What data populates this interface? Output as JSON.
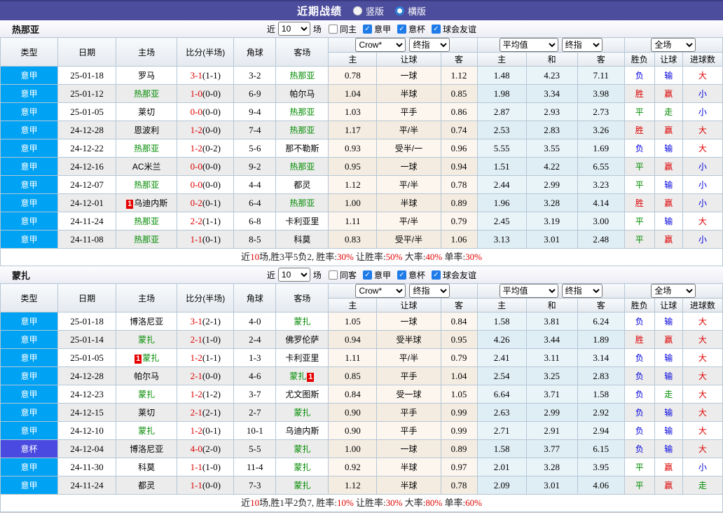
{
  "title_bar": {
    "title": "近期战绩",
    "radios": [
      {
        "label": "竖版",
        "checked": false
      },
      {
        "label": "横版",
        "checked": true
      }
    ]
  },
  "colors": {
    "titlebar_bg": "#4d4d9e",
    "serie_a_bg": "#00a2f3",
    "italy_cup_bg": "#4a4ae0",
    "win_red": "#dd0000",
    "draw_green": "#008a00",
    "lose_blue": "#0000dd",
    "team_green": "#008a00"
  },
  "columns": {
    "type": "类型",
    "date": "日期",
    "home": "主场",
    "score": "比分(半场)",
    "corner": "角球",
    "away": "客场",
    "odds_home": "主",
    "odds_handicap": "让球",
    "odds_away": "客",
    "avg_home": "主",
    "avg_draw": "和",
    "avg_away": "客",
    "result_wdl": "胜负",
    "result_handicap": "让球",
    "result_goals": "进球数"
  },
  "selects": {
    "source": "Crow*",
    "source_time": "终指",
    "average": "平均值",
    "average_time": "终指",
    "scope": "全场"
  },
  "sections": [
    {
      "team": "热那亚",
      "controls": {
        "near": "近",
        "count": "10",
        "games": "场",
        "same": {
          "label": "同主",
          "checked": false
        },
        "leagues": [
          {
            "label": "意甲",
            "checked": true
          },
          {
            "label": "意杯",
            "checked": true
          },
          {
            "label": "球会友谊",
            "checked": true
          }
        ]
      },
      "rows": [
        {
          "lg": "意甲",
          "lgc": "jia",
          "date": "25-01-18",
          "h": "罗马",
          "hg": false,
          "hb": "",
          "hba": "",
          "ft": "3-1",
          "ht": "(1-1)",
          "cn": "3-2",
          "a": "热那亚",
          "ag": true,
          "ab": "",
          "aba": "",
          "c1": "0.78",
          "chd": "一球",
          "c2": "1.12",
          "m1": "1.48",
          "mx": "4.23",
          "m2": "7.11",
          "r1": "负",
          "r2": "输",
          "r3": "大"
        },
        {
          "lg": "意甲",
          "lgc": "jia",
          "date": "25-01-12",
          "h": "热那亚",
          "hg": true,
          "hb": "",
          "hba": "",
          "ft": "1-0",
          "ht": "(0-0)",
          "cn": "6-9",
          "a": "帕尔马",
          "ag": false,
          "ab": "",
          "aba": "",
          "c1": "1.04",
          "chd": "半球",
          "c2": "0.85",
          "m1": "1.98",
          "mx": "3.34",
          "m2": "3.98",
          "r1": "胜",
          "r2": "赢",
          "r3": "小"
        },
        {
          "lg": "意甲",
          "lgc": "jia",
          "date": "25-01-05",
          "h": "莱切",
          "hg": false,
          "hb": "",
          "hba": "",
          "ft": "0-0",
          "ht": "(0-0)",
          "cn": "9-4",
          "a": "热那亚",
          "ag": true,
          "ab": "",
          "aba": "",
          "c1": "1.03",
          "chd": "平手",
          "c2": "0.86",
          "m1": "2.87",
          "mx": "2.93",
          "m2": "2.73",
          "r1": "平",
          "r2": "走",
          "r3": "小"
        },
        {
          "lg": "意甲",
          "lgc": "jia",
          "date": "24-12-28",
          "h": "恩波利",
          "hg": false,
          "hb": "",
          "hba": "",
          "ft": "1-2",
          "ht": "(0-0)",
          "cn": "7-4",
          "a": "热那亚",
          "ag": true,
          "ab": "",
          "aba": "",
          "c1": "1.17",
          "chd": "平/半",
          "c2": "0.74",
          "m1": "2.53",
          "mx": "2.83",
          "m2": "3.26",
          "r1": "胜",
          "r2": "赢",
          "r3": "大"
        },
        {
          "lg": "意甲",
          "lgc": "jia",
          "date": "24-12-22",
          "h": "热那亚",
          "hg": true,
          "hb": "",
          "hba": "",
          "ft": "1-2",
          "ht": "(0-2)",
          "cn": "5-6",
          "a": "那不勒斯",
          "ag": false,
          "ab": "",
          "aba": "",
          "c1": "0.93",
          "chd": "受半/一",
          "c2": "0.96",
          "m1": "5.55",
          "mx": "3.55",
          "m2": "1.69",
          "r1": "负",
          "r2": "输",
          "r3": "大"
        },
        {
          "lg": "意甲",
          "lgc": "jia",
          "date": "24-12-16",
          "h": "AC米兰",
          "hg": false,
          "hb": "",
          "hba": "",
          "ft": "0-0",
          "ht": "(0-0)",
          "cn": "9-2",
          "a": "热那亚",
          "ag": true,
          "ab": "",
          "aba": "",
          "c1": "0.95",
          "chd": "一球",
          "c2": "0.94",
          "m1": "1.51",
          "mx": "4.22",
          "m2": "6.55",
          "r1": "平",
          "r2": "赢",
          "r3": "小"
        },
        {
          "lg": "意甲",
          "lgc": "jia",
          "date": "24-12-07",
          "h": "热那亚",
          "hg": true,
          "hb": "",
          "hba": "",
          "ft": "0-0",
          "ht": "(0-0)",
          "cn": "4-4",
          "a": "都灵",
          "ag": false,
          "ab": "",
          "aba": "",
          "c1": "1.12",
          "chd": "平/半",
          "c2": "0.78",
          "m1": "2.44",
          "mx": "2.99",
          "m2": "3.23",
          "r1": "平",
          "r2": "输",
          "r3": "小"
        },
        {
          "lg": "意甲",
          "lgc": "jia",
          "date": "24-12-01",
          "h": "乌迪内斯",
          "hg": false,
          "hb": "1",
          "hba": "",
          "ft": "0-2",
          "ht": "(0-1)",
          "cn": "6-4",
          "a": "热那亚",
          "ag": true,
          "ab": "",
          "aba": "",
          "c1": "1.00",
          "chd": "半球",
          "c2": "0.89",
          "m1": "1.96",
          "mx": "3.28",
          "m2": "4.14",
          "r1": "胜",
          "r2": "赢",
          "r3": "小"
        },
        {
          "lg": "意甲",
          "lgc": "jia",
          "date": "24-11-24",
          "h": "热那亚",
          "hg": true,
          "hb": "",
          "hba": "",
          "ft": "2-2",
          "ht": "(1-1)",
          "cn": "6-8",
          "a": "卡利亚里",
          "ag": false,
          "ab": "",
          "aba": "",
          "c1": "1.11",
          "chd": "平/半",
          "c2": "0.79",
          "m1": "2.45",
          "mx": "3.19",
          "m2": "3.00",
          "r1": "平",
          "r2": "输",
          "r3": "大"
        },
        {
          "lg": "意甲",
          "lgc": "jia",
          "date": "24-11-08",
          "h": "热那亚",
          "hg": true,
          "hb": "",
          "hba": "",
          "ft": "1-1",
          "ht": "(0-1)",
          "cn": "8-5",
          "a": "科莫",
          "ag": false,
          "ab": "",
          "aba": "",
          "c1": "0.83",
          "chd": "受平/半",
          "c2": "1.06",
          "m1": "3.13",
          "mx": "3.01",
          "m2": "2.48",
          "r1": "平",
          "r2": "赢",
          "r3": "小"
        }
      ],
      "summary": [
        {
          "t": "近",
          "hl": false
        },
        {
          "t": "10",
          "hl": true
        },
        {
          "t": "场,胜3平5负2, 胜率:",
          "hl": false
        },
        {
          "t": "30%",
          "hl": true
        },
        {
          "t": " 让胜率:",
          "hl": false
        },
        {
          "t": "50%",
          "hl": true
        },
        {
          "t": " 大率:",
          "hl": false
        },
        {
          "t": "40%",
          "hl": true
        },
        {
          "t": " 单率:",
          "hl": false
        },
        {
          "t": "30%",
          "hl": true
        }
      ]
    },
    {
      "team": "蒙扎",
      "controls": {
        "near": "近",
        "count": "10",
        "games": "场",
        "same": {
          "label": "同客",
          "checked": false
        },
        "leagues": [
          {
            "label": "意甲",
            "checked": true
          },
          {
            "label": "意杯",
            "checked": true
          },
          {
            "label": "球会友谊",
            "checked": true
          }
        ]
      },
      "rows": [
        {
          "lg": "意甲",
          "lgc": "jia",
          "date": "25-01-18",
          "h": "博洛尼亚",
          "hg": false,
          "hb": "",
          "hba": "",
          "ft": "3-1",
          "ht": "(2-1)",
          "cn": "4-0",
          "a": "蒙扎",
          "ag": true,
          "ab": "",
          "aba": "",
          "c1": "1.05",
          "chd": "一球",
          "c2": "0.84",
          "m1": "1.58",
          "mx": "3.81",
          "m2": "6.24",
          "r1": "负",
          "r2": "输",
          "r3": "大"
        },
        {
          "lg": "意甲",
          "lgc": "jia",
          "date": "25-01-14",
          "h": "蒙扎",
          "hg": true,
          "hb": "",
          "hba": "",
          "ft": "2-1",
          "ht": "(1-0)",
          "cn": "2-4",
          "a": "佛罗伦萨",
          "ag": false,
          "ab": "",
          "aba": "",
          "c1": "0.94",
          "chd": "受半球",
          "c2": "0.95",
          "m1": "4.26",
          "mx": "3.44",
          "m2": "1.89",
          "r1": "胜",
          "r2": "赢",
          "r3": "大"
        },
        {
          "lg": "意甲",
          "lgc": "jia",
          "date": "25-01-05",
          "h": "蒙扎",
          "hg": true,
          "hb": "1",
          "hba": "",
          "ft": "1-2",
          "ht": "(1-1)",
          "cn": "1-3",
          "a": "卡利亚里",
          "ag": false,
          "ab": "",
          "aba": "",
          "c1": "1.11",
          "chd": "平/半",
          "c2": "0.79",
          "m1": "2.41",
          "mx": "3.11",
          "m2": "3.14",
          "r1": "负",
          "r2": "输",
          "r3": "大"
        },
        {
          "lg": "意甲",
          "lgc": "jia",
          "date": "24-12-28",
          "h": "帕尔马",
          "hg": false,
          "hb": "",
          "hba": "",
          "ft": "2-1",
          "ht": "(0-0)",
          "cn": "4-6",
          "a": "蒙扎",
          "ag": true,
          "ab": "",
          "aba": "1",
          "c1": "0.85",
          "chd": "平手",
          "c2": "1.04",
          "m1": "2.54",
          "mx": "3.25",
          "m2": "2.83",
          "r1": "负",
          "r2": "输",
          "r3": "大"
        },
        {
          "lg": "意甲",
          "lgc": "jia",
          "date": "24-12-23",
          "h": "蒙扎",
          "hg": true,
          "hb": "",
          "hba": "",
          "ft": "1-2",
          "ht": "(1-2)",
          "cn": "3-7",
          "a": "尤文图斯",
          "ag": false,
          "ab": "",
          "aba": "",
          "c1": "0.84",
          "chd": "受一球",
          "c2": "1.05",
          "m1": "6.64",
          "mx": "3.71",
          "m2": "1.58",
          "r1": "负",
          "r2": "走",
          "r3": "大"
        },
        {
          "lg": "意甲",
          "lgc": "jia",
          "date": "24-12-15",
          "h": "莱切",
          "hg": false,
          "hb": "",
          "hba": "",
          "ft": "2-1",
          "ht": "(2-1)",
          "cn": "2-7",
          "a": "蒙扎",
          "ag": true,
          "ab": "",
          "aba": "",
          "c1": "0.90",
          "chd": "平手",
          "c2": "0.99",
          "m1": "2.63",
          "mx": "2.99",
          "m2": "2.92",
          "r1": "负",
          "r2": "输",
          "r3": "大"
        },
        {
          "lg": "意甲",
          "lgc": "jia",
          "date": "24-12-10",
          "h": "蒙扎",
          "hg": true,
          "hb": "",
          "hba": "",
          "ft": "1-2",
          "ht": "(0-1)",
          "cn": "10-1",
          "a": "乌迪内斯",
          "ag": false,
          "ab": "",
          "aba": "",
          "c1": "0.90",
          "chd": "平手",
          "c2": "0.99",
          "m1": "2.71",
          "mx": "2.91",
          "m2": "2.94",
          "r1": "负",
          "r2": "输",
          "r3": "大"
        },
        {
          "lg": "意杯",
          "lgc": "bei",
          "date": "24-12-04",
          "h": "博洛尼亚",
          "hg": false,
          "hb": "",
          "hba": "",
          "ft": "4-0",
          "ht": "(2-0)",
          "cn": "5-5",
          "a": "蒙扎",
          "ag": true,
          "ab": "",
          "aba": "",
          "c1": "1.00",
          "chd": "一球",
          "c2": "0.89",
          "m1": "1.58",
          "mx": "3.77",
          "m2": "6.15",
          "r1": "负",
          "r2": "输",
          "r3": "大"
        },
        {
          "lg": "意甲",
          "lgc": "jia",
          "date": "24-11-30",
          "h": "科莫",
          "hg": false,
          "hb": "",
          "hba": "",
          "ft": "1-1",
          "ht": "(1-0)",
          "cn": "11-4",
          "a": "蒙扎",
          "ag": true,
          "ab": "",
          "aba": "",
          "c1": "0.92",
          "chd": "半球",
          "c2": "0.97",
          "m1": "2.01",
          "mx": "3.28",
          "m2": "3.95",
          "r1": "平",
          "r2": "赢",
          "r3": "小"
        },
        {
          "lg": "意甲",
          "lgc": "jia",
          "date": "24-11-24",
          "h": "都灵",
          "hg": false,
          "hb": "",
          "hba": "",
          "ft": "1-1",
          "ht": "(0-0)",
          "cn": "7-3",
          "a": "蒙扎",
          "ag": true,
          "ab": "",
          "aba": "",
          "c1": "1.12",
          "chd": "半球",
          "c2": "0.78",
          "m1": "2.09",
          "mx": "3.01",
          "m2": "4.06",
          "r1": "平",
          "r2": "赢",
          "r3": "走"
        }
      ],
      "summary": [
        {
          "t": "近",
          "hl": false
        },
        {
          "t": "10",
          "hl": true
        },
        {
          "t": "场,胜1平2负7, 胜率:",
          "hl": false
        },
        {
          "t": "10%",
          "hl": true
        },
        {
          "t": " 让胜率:",
          "hl": false
        },
        {
          "t": "30%",
          "hl": true
        },
        {
          "t": " 大率:",
          "hl": false
        },
        {
          "t": "80%",
          "hl": true
        },
        {
          "t": " 单率:",
          "hl": false
        },
        {
          "t": "60%",
          "hl": true
        }
      ]
    }
  ]
}
